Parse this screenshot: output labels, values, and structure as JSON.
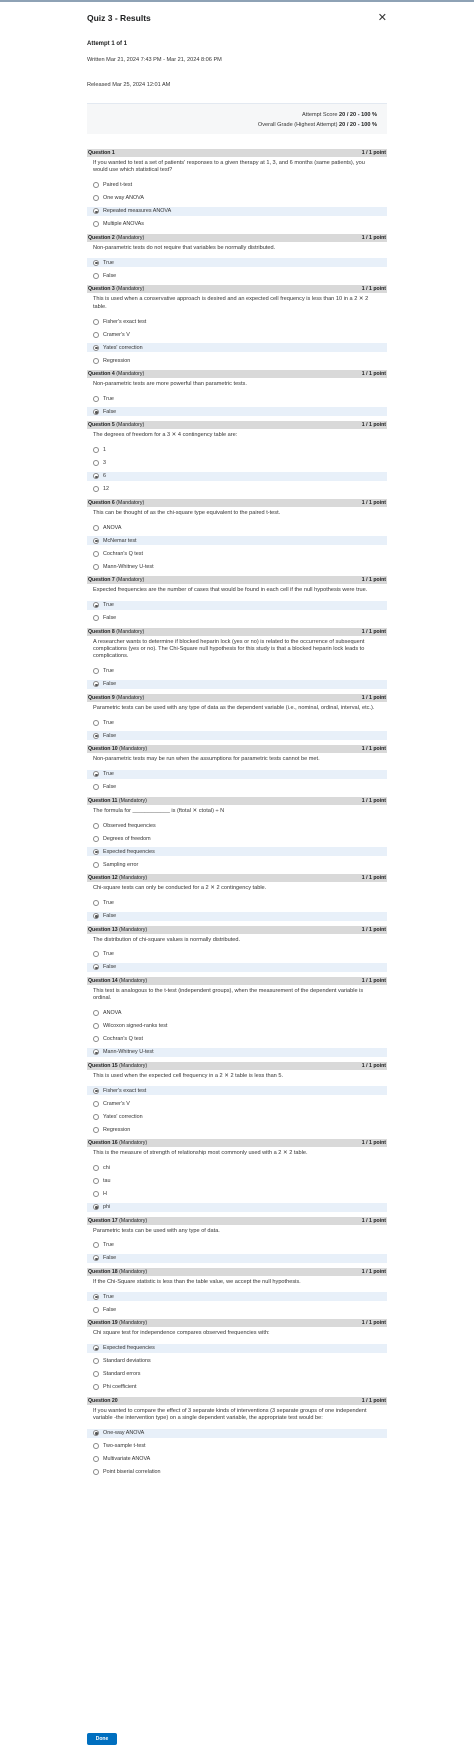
{
  "header": {
    "title": "Quiz 3 - Results",
    "close_icon": "close-icon"
  },
  "attempt": {
    "label": "Attempt 1 of 1",
    "written": "Written Mar 21, 2024 7:43 PM - Mar 21, 2024 8:06 PM",
    "released": "Released Mar 25, 2024 12:01 AM"
  },
  "score": {
    "attempt_label": "Attempt Score",
    "attempt_value": "20 / 20 - 100 %",
    "overall_label": "Overall Grade (Highest Attempt)",
    "overall_value": "20 / 20 - 100 %"
  },
  "questions": [
    {
      "label": "Question 1",
      "tag": "",
      "points": "1 / 1 point",
      "text": "If you wanted to test a set of patients' responses to a given therapy at 1, 3, and 6 months (same patients), you would use which statistical test?",
      "options": [
        "Paired t-test",
        "One way ANOVA",
        "Repeated measures ANOVA",
        "Multiple ANOVAs"
      ],
      "selected": 2
    },
    {
      "label": "Question 2",
      "tag": "(Mandatory)",
      "points": "1 / 1 point",
      "text": "Non-parametric tests do not require that variables be normally distributed.",
      "options": [
        "True",
        "False"
      ],
      "selected": 0
    },
    {
      "label": "Question 3",
      "tag": "(Mandatory)",
      "points": "1 / 1 point",
      "text": "This is used when a conservative approach is desired and an expected cell frequency is less than 10 in a 2 ✕ 2 table.",
      "options": [
        "Fisher's exact test",
        "Cramer's V",
        "Yates' correction",
        "Regression"
      ],
      "selected": 2
    },
    {
      "label": "Question 4",
      "tag": "(Mandatory)",
      "points": "1 / 1 point",
      "text": "Non-parametric tests are more powerful than parametric tests.",
      "options": [
        "True",
        "False"
      ],
      "selected": 1
    },
    {
      "label": "Question 5",
      "tag": "(Mandatory)",
      "points": "1 / 1 point",
      "text": "The degrees of freedom for a 3 ✕ 4 contingency table are:",
      "options": [
        "1",
        "3",
        "6",
        "12"
      ],
      "selected": 2
    },
    {
      "label": "Question 6",
      "tag": "(Mandatory)",
      "points": "1 / 1 point",
      "text": "This can be thought of as the chi-square type equivalent to the paired t-test.",
      "options": [
        "ANOVA",
        "McNemar test",
        "Cochran's Q test",
        "Mann-Whitney U-test"
      ],
      "selected": 1
    },
    {
      "label": "Question 7",
      "tag": "(Mandatory)",
      "points": "1 / 1 point",
      "text": "Expected frequencies are the number of cases that would be found in each cell if the null hypothesis were true.",
      "options": [
        "True",
        "False"
      ],
      "selected": 0
    },
    {
      "label": "Question 8",
      "tag": "(Mandatory)",
      "points": "1 / 1 point",
      "text": "A researcher wants to determine if blocked heparin lock (yes or no) is related to the occurrence of subsequent complications (yes or no). The Chi-Square null hypothesis for this study is that a blocked heparin lock leads to complications.",
      "options": [
        "True",
        "False"
      ],
      "selected": 1
    },
    {
      "label": "Question 9",
      "tag": "(Mandatory)",
      "points": "1 / 1 point",
      "text": "Parametric tests can be used with any type of data as the dependent variable (i.e., nominal, ordinal, interval, etc.).",
      "options": [
        "True",
        "False"
      ],
      "selected": 1
    },
    {
      "label": "Question 10",
      "tag": "(Mandatory)",
      "points": "1 / 1 point",
      "text": "Non-parametric tests may be run when the assumptions for parametric tests cannot be met.",
      "options": [
        "True",
        "False"
      ],
      "selected": 0
    },
    {
      "label": "Question 11",
      "tag": "(Mandatory)",
      "points": "1 / 1 point",
      "text": "The formula for ____________ is (ftotal ✕ ctotal) ÷ N",
      "options": [
        "Observed frequencies",
        "Degrees of freedom",
        "Expected frequencies",
        "Sampling error"
      ],
      "selected": 2
    },
    {
      "label": "Question 12",
      "tag": "(Mandatory)",
      "points": "1 / 1 point",
      "text": "Chi-square tests can only be conducted for a 2 ✕ 2 contingency table.",
      "options": [
        "True",
        "False"
      ],
      "selected": 1
    },
    {
      "label": "Question 13",
      "tag": "(Mandatory)",
      "points": "1 / 1 point",
      "text": "The distribution of chi-square values is normally distributed.",
      "options": [
        "True",
        "False"
      ],
      "selected": 1
    },
    {
      "label": "Question 14",
      "tag": "(Mandatory)",
      "points": "1 / 1 point",
      "text": "This test is analogous to the t-test (independent groups), when the measurement of the dependent variable is ordinal.",
      "options": [
        "ANOVA",
        "Wilcoxon signed-ranks test",
        "Cochran's Q test",
        "Mann-Whitney U-test"
      ],
      "selected": 3
    },
    {
      "label": "Question 15",
      "tag": "(Mandatory)",
      "points": "1 / 1 point",
      "text": "This is used when the expected cell frequency in a 2 ✕ 2 table is less than 5.",
      "options": [
        "Fisher's exact test",
        "Cramer's V",
        "Yates' correction",
        "Regression"
      ],
      "selected": 0
    },
    {
      "label": "Question 16",
      "tag": "(Mandatory)",
      "points": "1 / 1 point",
      "text": "This is the measure of strength of relationship most commonly used with a 2 ✕ 2 table.",
      "options": [
        "chi",
        "tau",
        "H",
        "phi"
      ],
      "selected": 3
    },
    {
      "label": "Question 17",
      "tag": "(Mandatory)",
      "points": "1 / 1 point",
      "text": "Parametric tests can be used with any type of data.",
      "options": [
        "True",
        "False"
      ],
      "selected": 1
    },
    {
      "label": "Question 18",
      "tag": "(Mandatory)",
      "points": "1 / 1 point",
      "text": "If the Chi-Square statistic is less than the table value, we accept the null hypothesis.",
      "options": [
        "True",
        "False"
      ],
      "selected": 0
    },
    {
      "label": "Question 19",
      "tag": "(Mandatory)",
      "points": "1 / 1 point",
      "text": "Chi square test for independence compares observed frequencies with:",
      "options": [
        "Expected frequencies",
        "Standard deviations",
        "Standard errors",
        "Phi coefficient"
      ],
      "selected": 0
    },
    {
      "label": "Question 20",
      "tag": "",
      "points": "1 / 1 point",
      "text": "If you wanted to compare the effect of 3 separate kinds of interventions (3 separate groups of one independent variable -the intervention type) on a single dependent variable, the appropriate test would be:",
      "options": [
        "One-way ANOVA",
        "Two-sample t-test",
        "Multivariate ANOVA",
        "Point biserial correlation"
      ],
      "selected": 0
    }
  ],
  "footer": {
    "done_label": "Done"
  },
  "colors": {
    "accent": "#006fbf",
    "question_header_bg": "#d9d9d9",
    "selected_option_bg": "#e8f0f9"
  }
}
